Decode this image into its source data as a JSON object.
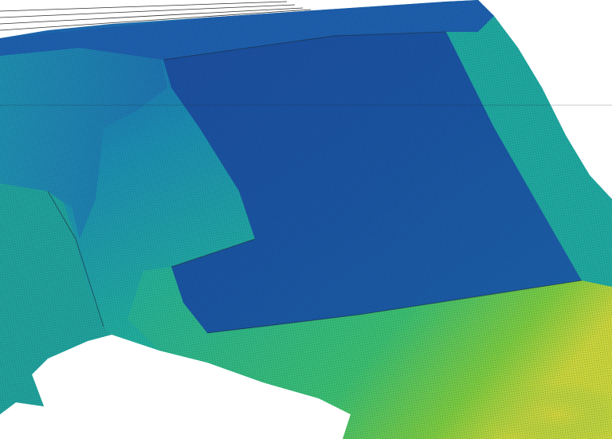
{
  "scene": {
    "background_color": "#ffffff",
    "surface_type": "3d-terrain-elevation-surface",
    "rendering": "wireframe-mesh-over-color-ramp",
    "mesh_line_color": "#0b2f4a",
    "edge_line_color": "#222222",
    "color_ramp": {
      "low": "#1f4fa8",
      "mid_low": "#1b7fb0",
      "mid": "#20b39a",
      "mid_high": "#3fc26a",
      "high": "#c8d43a"
    },
    "region_colors": {
      "plateau": "#1c56a0",
      "plateau_inner": "#1a5aa6",
      "upper_band": "#1e66b0",
      "left_slope": "#1f9ca6",
      "left_outer": "#22a9a0",
      "right_slope": "#1fb0a0",
      "foot_band": "#2cba8a",
      "lower_right": "#5cc64a",
      "peak": "#cfd83a"
    }
  }
}
